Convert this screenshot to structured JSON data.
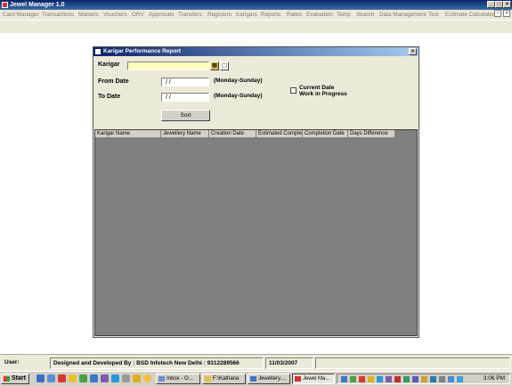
{
  "window": {
    "title": "Jewel Manager 1.0"
  },
  "menu": {
    "items": [
      "Card Manager",
      "Transactions",
      "Masters",
      "Vouchers",
      "ORV",
      "Approvals",
      "Transfers",
      "Registers",
      "Karigars",
      "Reports",
      "Rates",
      "Evaluation",
      "Temp",
      "Search",
      "Data Management",
      "Test",
      "Estimate Calculator"
    ]
  },
  "dialog": {
    "title": "Karigar Performance Report",
    "karigar_label": "Karigar",
    "karigar_value": "",
    "from_label": "From Date",
    "from_value": "/  /",
    "from_hint": "(Monday-Sunday)",
    "to_label": "To Date",
    "to_value": "/  /",
    "to_hint": "(Monday-Sunday)",
    "checkbox_line1": "Current Date",
    "checkbox_line2": "Work in Progress",
    "checkbox_checked": false,
    "sort_label": "Sort",
    "columns": [
      "Karigar Name",
      "Jewellery Name",
      "Creation Date",
      "Estimated Complet",
      "Completion Date",
      "Days Difference"
    ]
  },
  "status": {
    "user": "User:",
    "credit": "Designed and Developed By : BSD Infotech New Delhi : 9312289566",
    "date": "11/03/2007"
  },
  "taskbar": {
    "start": "Start",
    "tasks": [
      {
        "label": "Inbox - O...",
        "active": false
      },
      {
        "label": "F:\\Kathana",
        "active": false
      },
      {
        "label": "Jewellery....",
        "active": false
      },
      {
        "label": "Jewel Ma...",
        "active": true
      }
    ],
    "clock": "3:06 PM"
  },
  "colors": {
    "title_blue": "#0a246a",
    "face": "#ece9d8",
    "grid_bg": "#808080",
    "field_yellow": "#ffffc0"
  }
}
